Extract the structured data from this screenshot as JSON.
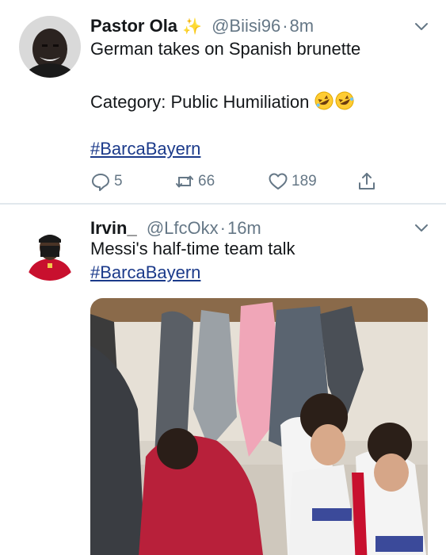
{
  "tweets": [
    {
      "name": "Pastor Ola",
      "name_emoji": "✨",
      "handle": "@Biisi96",
      "separator": "·",
      "time": "8m",
      "text_line1": "German takes on Spanish brunette",
      "text_line2": "Category: Public Humiliation",
      "hashtag": "#BarcaBayern",
      "replies": "5",
      "retweets": "66",
      "likes": "189"
    },
    {
      "name": "Irvin_",
      "handle": "@LfcOkx",
      "separator": "·",
      "time": "16m",
      "text_line1": "Messi's half-time team talk",
      "hashtag": "#BarcaBayern"
    }
  ],
  "colors": {
    "text": "#14171a",
    "secondary": "#657786",
    "hashtag": "#1b3a8a",
    "divider": "#e1e8ed"
  }
}
